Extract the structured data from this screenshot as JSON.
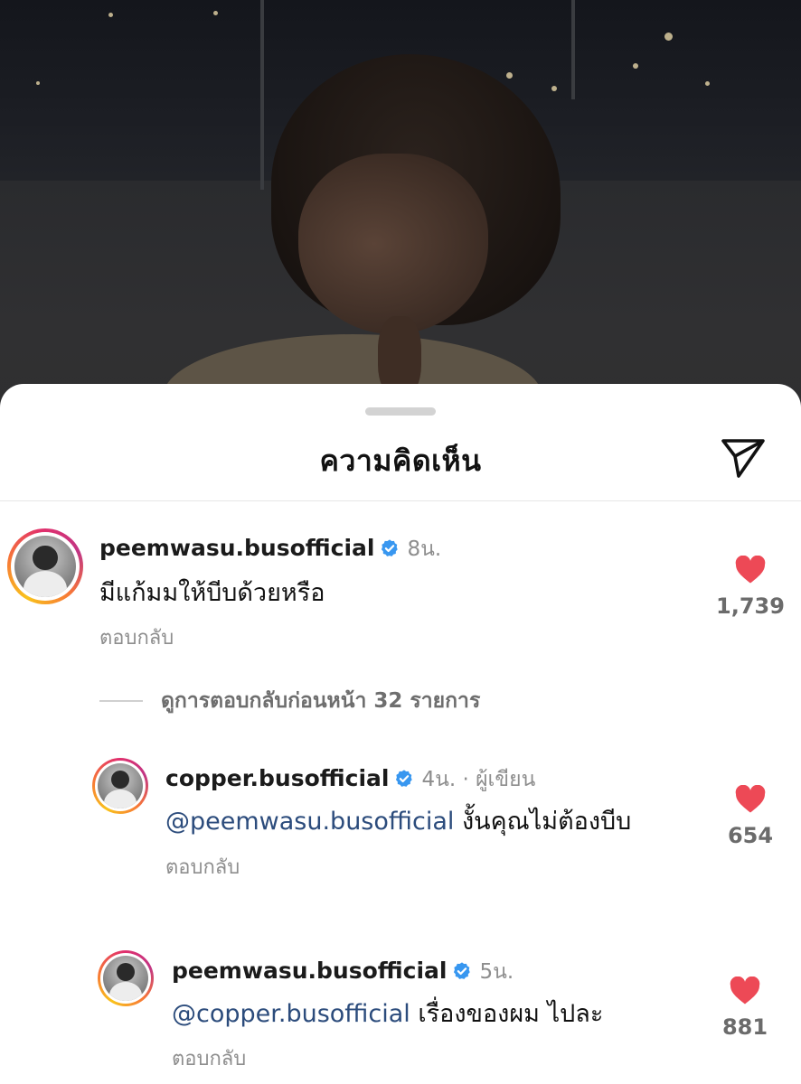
{
  "sheet": {
    "title": "ความคิดเห็น",
    "send_icon": "paper-plane-icon"
  },
  "colors": {
    "like_red": "#ed4956",
    "verified_blue": "#3897f0",
    "mention": "#2c4c7c",
    "muted": "#8e8e8e"
  },
  "comments": [
    {
      "username": "peemwasu.busofficial",
      "time": "8น.",
      "text": "มีแก้มมให้บีบด้วยหรือ",
      "reply_label": "ตอบกลับ",
      "likes": "1,739"
    }
  ],
  "view_replies": "ดูการตอบกลับก่อนหน้า 32 รายการ",
  "replies": [
    {
      "username": "copper.busofficial",
      "time": "4น. · ผู้เขียน",
      "mention": "@peemwasu.busofficial",
      "text": " งั้นคุณไม่ต้องบีบ",
      "reply_label": "ตอบกลับ",
      "likes": "654"
    },
    {
      "username": "peemwasu.busofficial",
      "time": "5น.",
      "mention": "@copper.busofficial",
      "text": " เรื่องของผม ไปละ",
      "reply_label": "ตอบกลับ",
      "likes": "881"
    }
  ]
}
